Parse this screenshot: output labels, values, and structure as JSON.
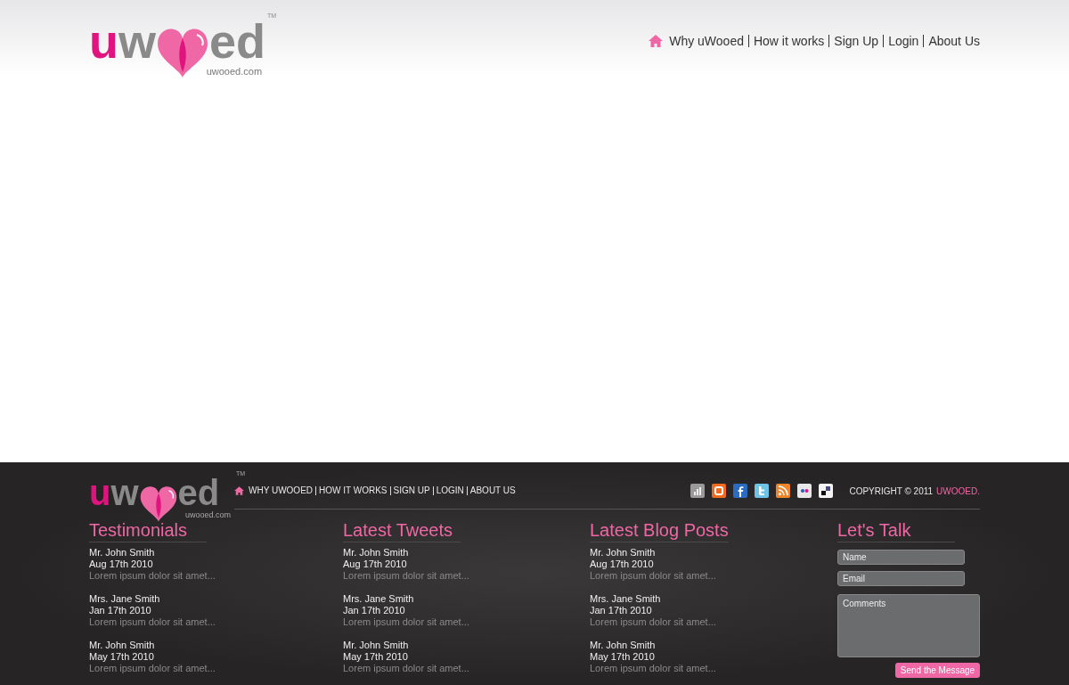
{
  "logo": {
    "letter_1": "u",
    "letter_2": "w",
    "suffix": "ed",
    "domain": "uwooed.com",
    "trademark": "TM"
  },
  "nav": [
    "Why uWooed",
    "How it works",
    "Sign Up",
    "Login",
    "About Us"
  ],
  "footer": {
    "logo": {
      "letter_1": "u",
      "letter_2": "w",
      "suffix": "ed",
      "domain": "uwooed.com",
      "trademark": "TM"
    },
    "nav": [
      "WHY UWOOED",
      "HOW IT WORKS",
      "SIGN UP",
      "LOGIN",
      "ABOUT US"
    ],
    "copyright": "COPYRIGHT © 2011",
    "brand": "UWOOED.",
    "columns": [
      {
        "title": "Testimonials",
        "entries": [
          {
            "name": "Mr. John Smith",
            "date": "Aug 17th 2010",
            "text": "Lorem ipsum dolor sit amet..."
          },
          {
            "name": "Mrs. Jane Smith",
            "date": "Jan 17th 2010",
            "text": "Lorem ipsum dolor sit amet..."
          },
          {
            "name": "Mr. John Smith",
            "date": "May 17th 2010",
            "text": "Lorem ipsum dolor sit amet..."
          }
        ]
      },
      {
        "title": "Latest Tweets",
        "entries": [
          {
            "name": "Mr. John Smith",
            "date": "Aug 17th 2010",
            "text": "Lorem ipsum dolor sit amet..."
          },
          {
            "name": "Mrs. Jane Smith",
            "date": "Jan 17th 2010",
            "text": "Lorem ipsum dolor sit amet..."
          },
          {
            "name": "Mr. John Smith",
            "date": "May 17th 2010",
            "text": "Lorem ipsum dolor sit amet..."
          }
        ]
      },
      {
        "title": "Latest Blog Posts",
        "entries": [
          {
            "name": "Mr. John Smith",
            "date": "Aug 17th 2010",
            "text": "Lorem ipsum dolor sit amet..."
          },
          {
            "name": "Mrs. Jane Smith",
            "date": "Jan 17th 2010",
            "text": "Lorem ipsum dolor sit amet..."
          },
          {
            "name": "Mr. John Smith",
            "date": "May 17th 2010",
            "text": "Lorem ipsum dolor sit amet..."
          }
        ]
      }
    ],
    "contact": {
      "title": "Let's Talk",
      "name": {
        "placeholder": "Name"
      },
      "email": {
        "placeholder": "Email"
      },
      "comments": {
        "placeholder": "Comments"
      },
      "submit": "Send the Message"
    }
  }
}
